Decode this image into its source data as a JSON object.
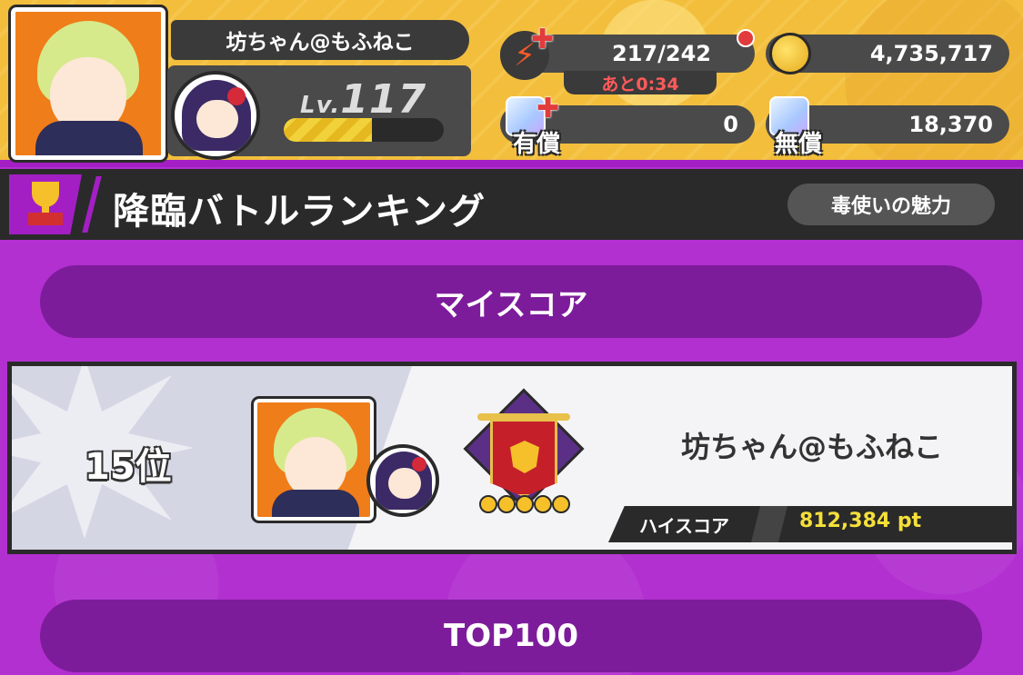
{
  "profile": {
    "name": "坊ちゃん@もふねこ",
    "level_prefix": "Lv.",
    "level": "117",
    "xp_progress": 0.55
  },
  "resources": {
    "energy": "217/242",
    "energy_timer": "あと0:34",
    "coins": "4,735,717",
    "paid_gems_label": "有償",
    "paid_gems": "0",
    "free_gems_label": "無償",
    "free_gems": "18,370"
  },
  "title_bar": {
    "title": "降臨バトルランキング",
    "theme": "毒使いの魅力"
  },
  "my_score": {
    "section_label": "マイスコア",
    "rank": "15位",
    "player_name": "坊ちゃん@もふねこ",
    "high_score_label": "ハイスコア",
    "high_score": "812,384 pt"
  },
  "top100": {
    "section_label": "TOP100"
  },
  "colors": {
    "header_yellow": "#f2be3c",
    "purple": "#b22fd0",
    "dark_purple": "#7d1c9a",
    "dark": "#2a2a2a",
    "score_yellow": "#f5e03a"
  }
}
